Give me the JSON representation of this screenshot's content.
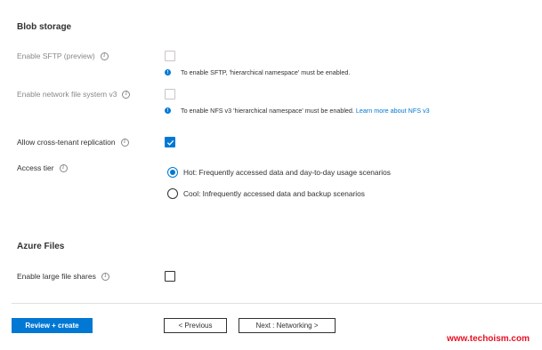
{
  "blob_storage": {
    "title": "Blob storage",
    "sftp": {
      "label": "Enable SFTP (preview)",
      "checked": false,
      "disabled": true,
      "note": "To enable SFTP, 'hierarchical namespace' must be enabled."
    },
    "nfs": {
      "label": "Enable network file system v3",
      "checked": false,
      "disabled": true,
      "note": "To enable NFS v3 'hierarchical namespace' must be enabled.",
      "link": "Learn more about NFS v3"
    },
    "cross_tenant": {
      "label": "Allow cross-tenant replication",
      "checked": true
    },
    "access_tier": {
      "label": "Access tier",
      "options": [
        {
          "label": "Hot: Frequently accessed data and day-to-day usage scenarios",
          "selected": true
        },
        {
          "label": "Cool: Infrequently accessed data and backup scenarios",
          "selected": false
        }
      ]
    }
  },
  "azure_files": {
    "title": "Azure Files",
    "large_file_shares": {
      "label": "Enable large file shares",
      "checked": false
    }
  },
  "footer": {
    "review_create": "Review + create",
    "previous": "< Previous",
    "next": "Next : Networking >"
  },
  "watermark": "www.techoism.com",
  "colors": {
    "accent": "#0078d4",
    "watermark": "#e81123"
  }
}
